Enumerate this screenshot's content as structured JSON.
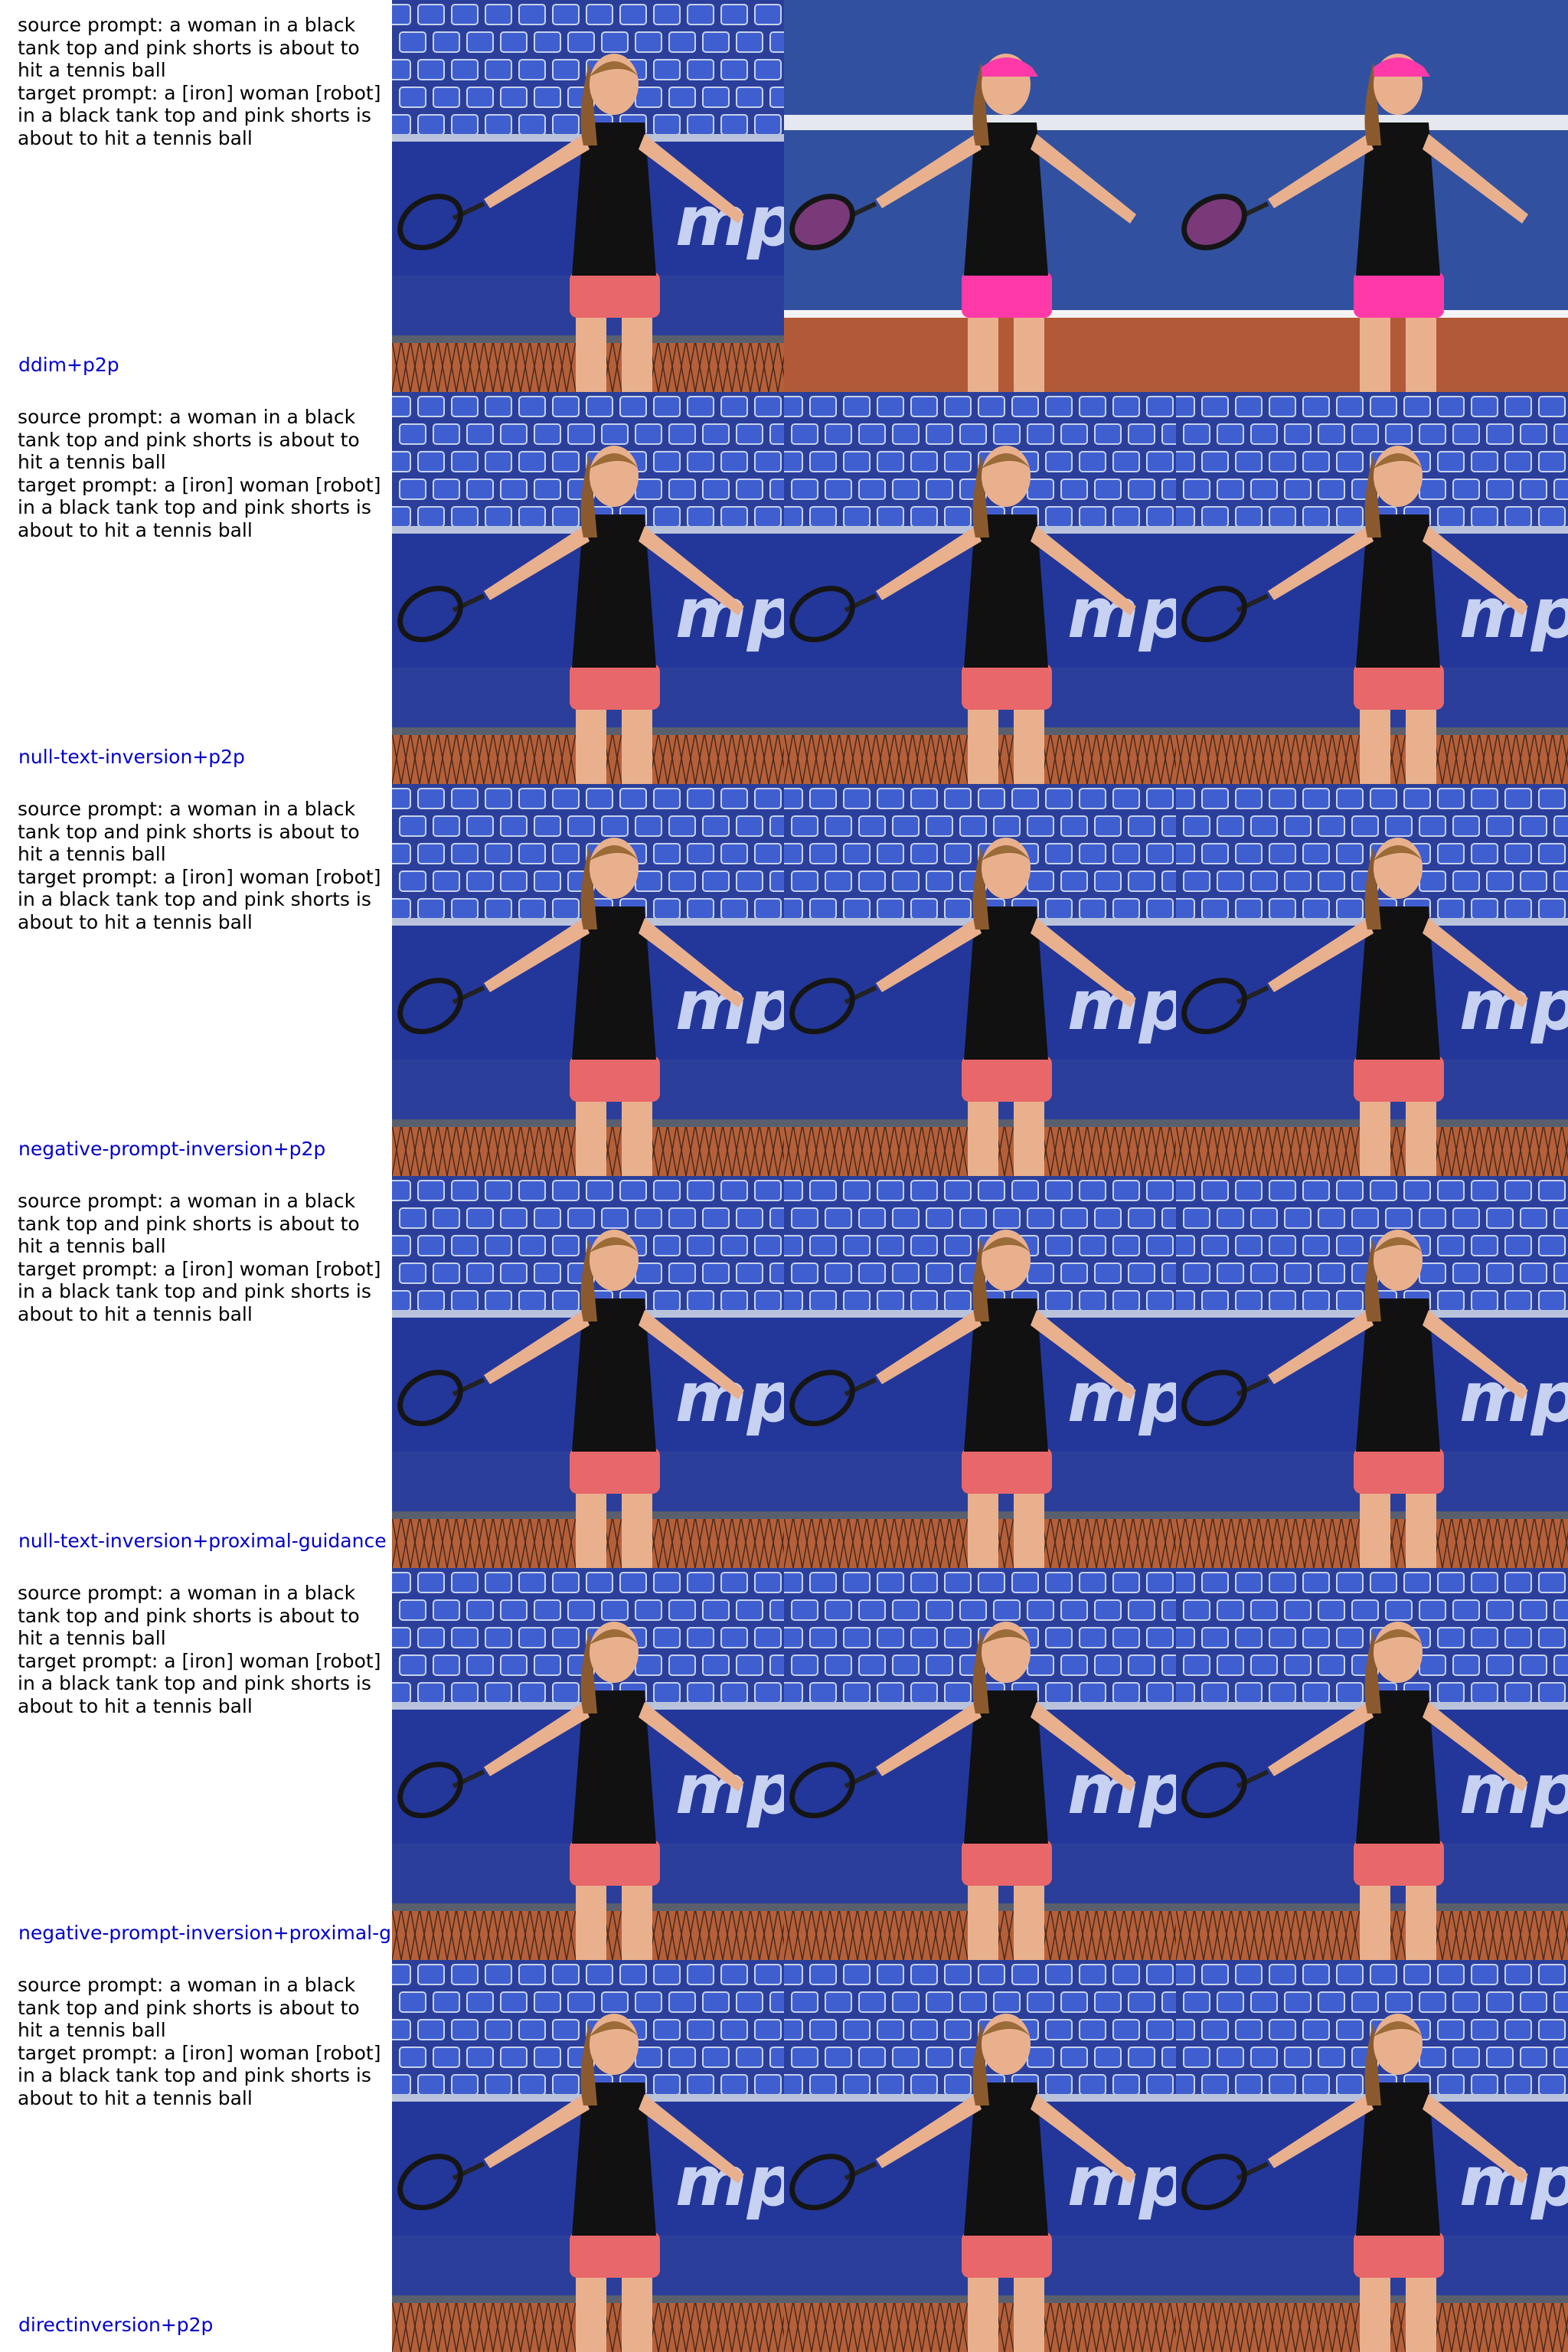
{
  "rows": [
    {
      "source_prompt": "source prompt: a woman in a black\ntank top and pink shorts is about to\nhit a tennis ball",
      "target_prompt": "target prompt: a [iron] woman [robot]\nin a black tank top and pink shorts is\nabout to hit a tennis ball",
      "method": "ddim+p2p"
    },
    {
      "source_prompt": "source prompt: a woman in a black\ntank top and pink shorts is about to\nhit a tennis ball",
      "target_prompt": "target prompt: a [iron] woman [robot]\nin a black tank top and pink shorts is\nabout to hit a tennis ball",
      "method": "null-text-inversion+p2p"
    },
    {
      "source_prompt": "source prompt: a woman in a black\ntank top and pink shorts is about to\nhit a tennis ball",
      "target_prompt": "target prompt: a [iron] woman [robot]\nin a black tank top and pink shorts is\nabout to hit a tennis ball",
      "method": "negative-prompt-inversion+p2p"
    },
    {
      "source_prompt": "source prompt: a woman in a black\ntank top and pink shorts is about to\nhit a tennis ball",
      "target_prompt": "target prompt: a [iron] woman [robot]\nin a black tank top and pink shorts is\nabout to hit a tennis ball",
      "method": "null-text-inversion+proximal-guidance"
    },
    {
      "source_prompt": "source prompt: a woman in a black\ntank top and pink shorts is about to\nhit a tennis ball",
      "target_prompt": "target prompt: a [iron] woman [robot]\nin a black tank top and pink shorts is\nabout to hit a tennis ball",
      "method": "negative-prompt-inversion+proximal-g"
    },
    {
      "source_prompt": "source prompt: a woman in a black\ntank top and pink shorts is about to\nhit a tennis ball",
      "target_prompt": "target prompt: a [iron] woman [robot]\nin a black tank top and pink shorts is\nabout to hit a tennis ball",
      "method": "directinversion+p2p"
    }
  ],
  "image_columns": [
    "source-image",
    "reconstructed-image",
    "edited-image"
  ],
  "colors": {
    "method_label": "#0000cc",
    "prompt_text": "#000000",
    "stadium_blue": "#2a3f9e",
    "shorts_pink": "#e8676a",
    "shorts_magenta": "#ff3aa8",
    "clay": "#b5603a"
  }
}
